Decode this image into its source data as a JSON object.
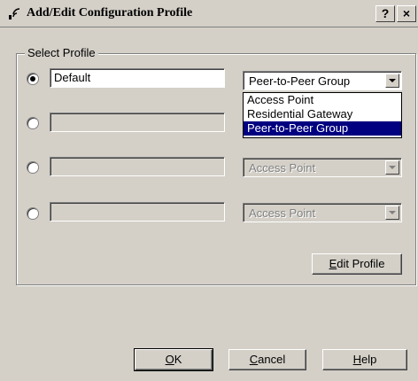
{
  "window": {
    "title": "Add/Edit Configuration Profile",
    "help_label": "?",
    "close_label": "×"
  },
  "group": {
    "label": "Select Profile"
  },
  "profiles": [
    {
      "name": "Default",
      "type": "Peer-to-Peer Group",
      "checked": true,
      "enabled": true
    },
    {
      "name": "",
      "type": "",
      "checked": false,
      "enabled": false
    },
    {
      "name": "",
      "type": "Access Point",
      "checked": false,
      "enabled": false
    },
    {
      "name": "",
      "type": "Access Point",
      "checked": false,
      "enabled": false
    }
  ],
  "dropdown": {
    "options": [
      "Access Point",
      "Residential Gateway",
      "Peer-to-Peer Group"
    ],
    "selected": "Peer-to-Peer Group"
  },
  "buttons": {
    "edit_profile": "Edit Profile",
    "edit_profile_mnemonic": "E",
    "ok": "OK",
    "ok_mnemonic": "O",
    "cancel": "Cancel",
    "cancel_mnemonic": "C",
    "help": "Help",
    "help_mnemonic": "H"
  },
  "colors": {
    "face": "#d4d0c8",
    "highlight": "#000080"
  }
}
